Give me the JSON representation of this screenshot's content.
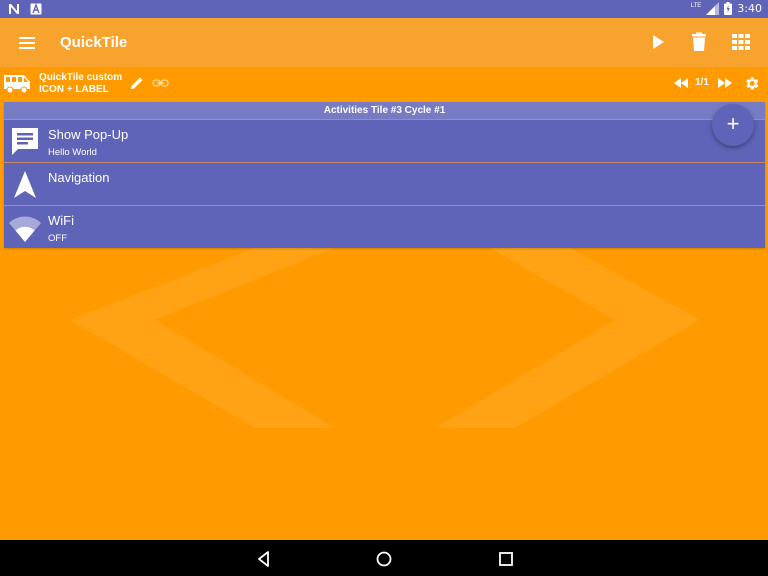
{
  "status_bar": {
    "time": "3:40",
    "network": "LTE",
    "icons": [
      "n-notification-icon",
      "a-notification-icon",
      "signal-icon",
      "battery-icon"
    ]
  },
  "app_bar": {
    "title": "QuickTile",
    "actions": [
      "play-icon",
      "delete-icon",
      "grid-icon"
    ]
  },
  "tile_bar": {
    "name_line1": "QuickTile custom",
    "name_line2": "ICON + LABEL",
    "pager": "1/1"
  },
  "list": {
    "header": "Activities Tile #3 Cycle #1",
    "items": [
      {
        "title": "Show Pop-Up",
        "subtitle": "Hello World",
        "icon": "chat-icon"
      },
      {
        "title": "Navigation",
        "subtitle": "",
        "icon": "navigation-icon"
      },
      {
        "title": "WiFi",
        "subtitle": "OFF",
        "icon": "wifi-icon"
      }
    ]
  },
  "fab": {
    "label": "+"
  },
  "colors": {
    "primary": "#6064b8",
    "accent": "#ff9b00",
    "app_bar": "#f7a32e"
  }
}
